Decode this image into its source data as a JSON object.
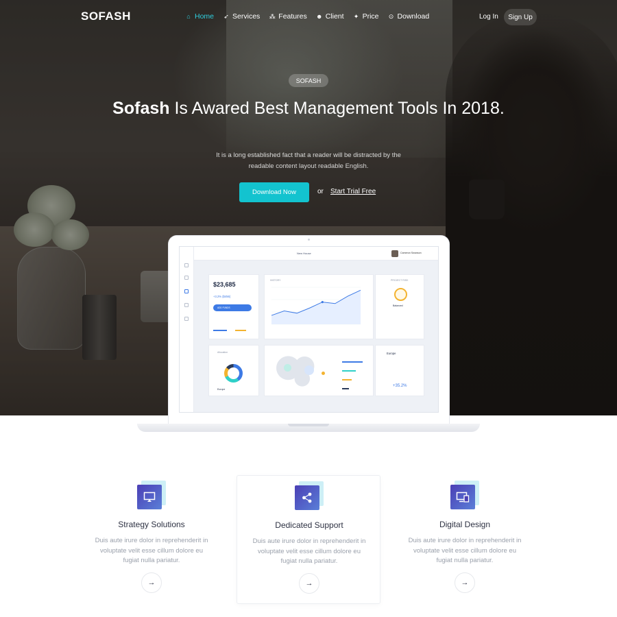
{
  "brand": {
    "logo": "SOFASH",
    "accent": "#13c3cf"
  },
  "nav": {
    "links": [
      {
        "label": "Home",
        "icon": "home-icon",
        "active": true
      },
      {
        "label": "Services",
        "icon": "rocket-icon"
      },
      {
        "label": "Features",
        "icon": "features-icon"
      },
      {
        "label": "Client",
        "icon": "users-icon"
      },
      {
        "label": "Price",
        "icon": "sparkle-icon"
      },
      {
        "label": "Download",
        "icon": "download-icon"
      }
    ],
    "login": "Log In",
    "signup": "Sign Up"
  },
  "hero": {
    "badge": "SOFASH",
    "headline_bold": "Sofash",
    "headline_rest": " Is Awared Best Management Tools In 2018.",
    "subtitle": "It is a long established fact that a reader will be distracted by the readable content layout readable English.",
    "primary_button": "Download Now",
    "or_text": "or",
    "secondary_link": "Start Trial Free"
  },
  "dashboard": {
    "tab": "New House",
    "user": "Cameron Swanson",
    "balance": "$23,685",
    "gain": "+3.2% ($456)",
    "add_funds": "ADD FUNDS",
    "history_label": "HISTORY",
    "risk_label": "PROJECT RISK",
    "risk_value": "Balanced",
    "allocation_tab": "Allocation",
    "region": "Europe",
    "region_pct": "+35.2%",
    "line_points": [
      12,
      18,
      15,
      22,
      30,
      28,
      38,
      46
    ]
  },
  "features": [
    {
      "title": "Strategy Solutions",
      "text": "Duis aute irure dolor in reprehenderit in voluptate velit esse cillum dolore eu fugiat nulla pariatur.",
      "icon": "monitor-icon"
    },
    {
      "title": "Dedicated Support",
      "text": "Duis aute irure dolor in reprehenderit in voluptate velit esse cillum dolore eu fugiat nulla pariatur.",
      "icon": "share-icon"
    },
    {
      "title": "Digital Design",
      "text": "Duis aute irure dolor in reprehenderit in voluptate velit esse cillum dolore eu fugiat nulla pariatur.",
      "icon": "devices-icon"
    }
  ]
}
